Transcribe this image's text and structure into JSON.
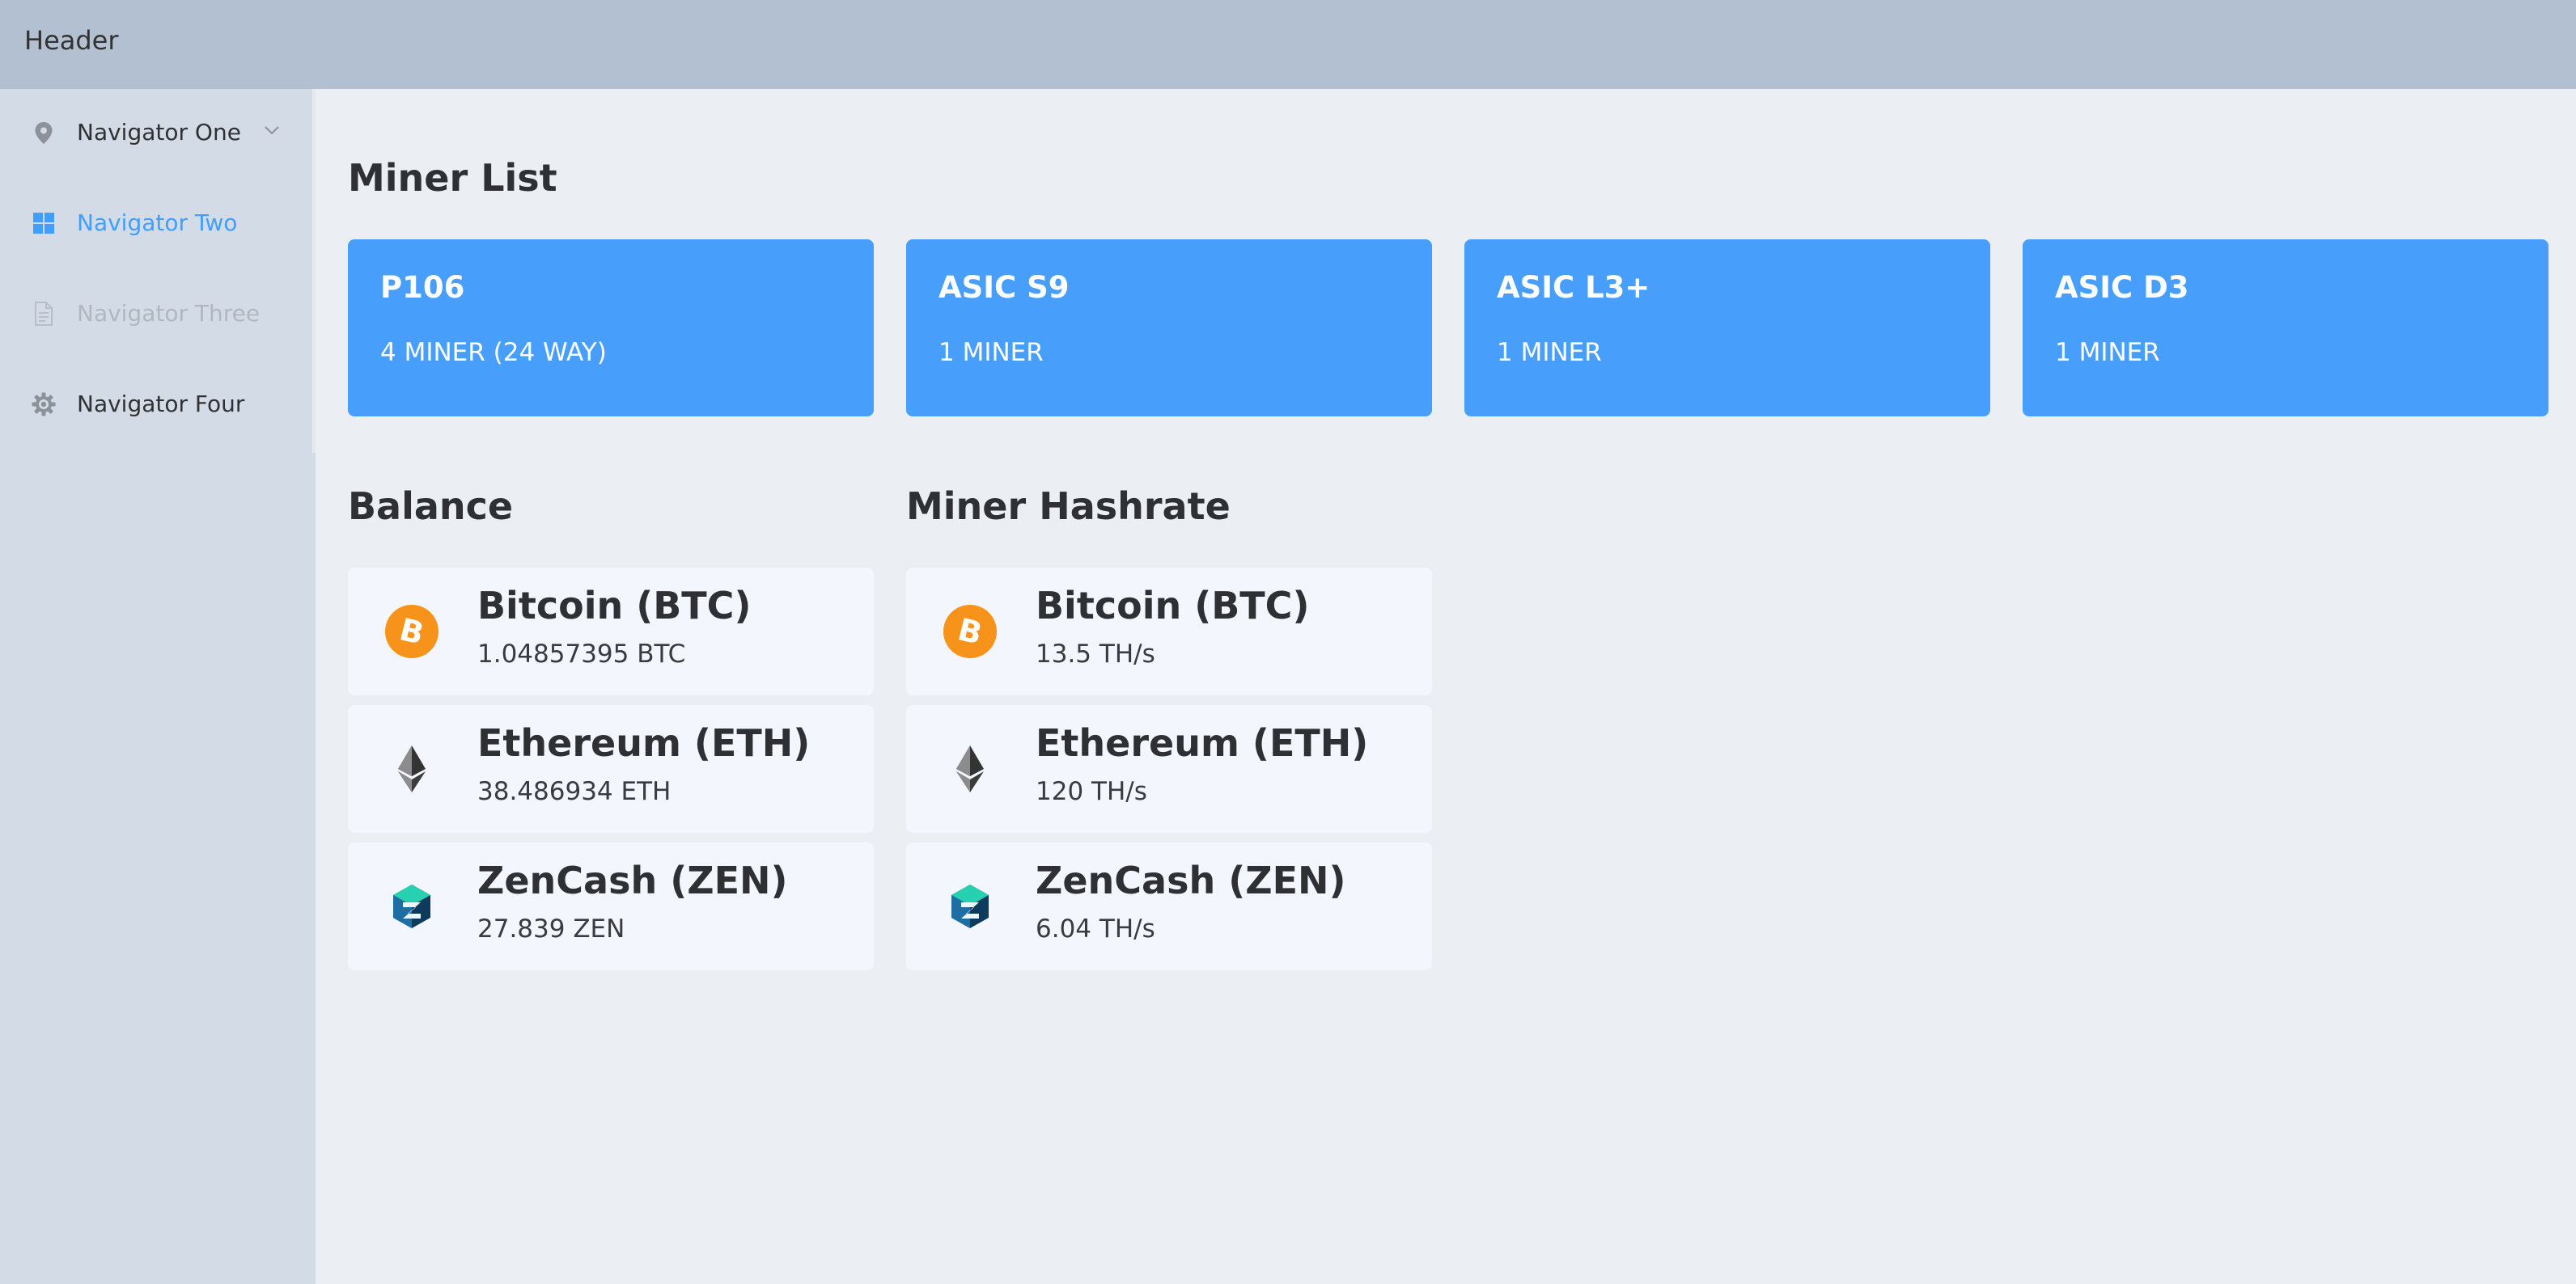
{
  "header": {
    "title": "Header"
  },
  "sidebar": {
    "items": [
      {
        "label": "Navigator One",
        "icon": "location-pin-icon",
        "state": "normal",
        "has_submenu": true
      },
      {
        "label": "Navigator Two",
        "icon": "grid-menu-icon",
        "state": "active"
      },
      {
        "label": "Navigator Three",
        "icon": "document-icon",
        "state": "disabled"
      },
      {
        "label": "Navigator Four",
        "icon": "gear-icon",
        "state": "normal"
      }
    ]
  },
  "miner_list": {
    "title": "Miner List",
    "cards": [
      {
        "name": "P106",
        "count": "4 MINER (24 WAY)"
      },
      {
        "name": "ASIC S9",
        "count": "1 MINER"
      },
      {
        "name": "ASIC L3+",
        "count": "1 MINER"
      },
      {
        "name": "ASIC D3",
        "count": "1 MINER"
      }
    ]
  },
  "balance": {
    "title": "Balance",
    "items": [
      {
        "name": "Bitcoin (BTC)",
        "value": "1.04857395 BTC",
        "icon": "bitcoin-icon"
      },
      {
        "name": "Ethereum (ETH)",
        "value": "38.486934 ETH",
        "icon": "ethereum-icon"
      },
      {
        "name": "ZenCash (ZEN)",
        "value": "27.839 ZEN",
        "icon": "zencash-icon"
      }
    ]
  },
  "hashrate": {
    "title": "Miner Hashrate",
    "items": [
      {
        "name": "Bitcoin (BTC)",
        "value": "13.5 TH/s",
        "icon": "bitcoin-icon"
      },
      {
        "name": "Ethereum (ETH)",
        "value": "120 TH/s",
        "icon": "ethereum-icon"
      },
      {
        "name": "ZenCash (ZEN)",
        "value": "6.04 TH/s",
        "icon": "zencash-icon"
      }
    ]
  },
  "colors": {
    "header_bg": "#b3c0d1",
    "sidebar_bg": "#d3dce6",
    "main_bg": "#ebeff3",
    "accent": "#409eff",
    "card_blue": "#479ffb",
    "coin_card_bg": "#f3f7fd"
  }
}
